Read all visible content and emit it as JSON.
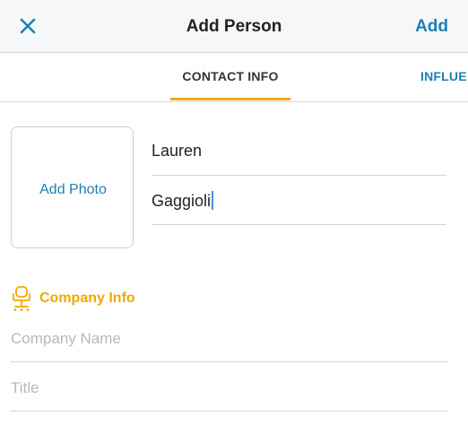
{
  "nav": {
    "title": "Add Person",
    "add_label": "Add",
    "close_icon": "close-x-icon"
  },
  "tabs": [
    {
      "label": "CONTACT INFO",
      "active": true
    },
    {
      "label": "INFLUE",
      "active": false
    }
  ],
  "photo": {
    "label": "Add Photo"
  },
  "name": {
    "first": "Lauren",
    "last": "Gaggioli"
  },
  "company_section": {
    "title": "Company Info",
    "icon": "office-chair-icon",
    "company_name_placeholder": "Company Name",
    "title_placeholder": "Title"
  },
  "colors": {
    "accent_blue": "#1a7fb5",
    "accent_orange": "#f2a800"
  }
}
